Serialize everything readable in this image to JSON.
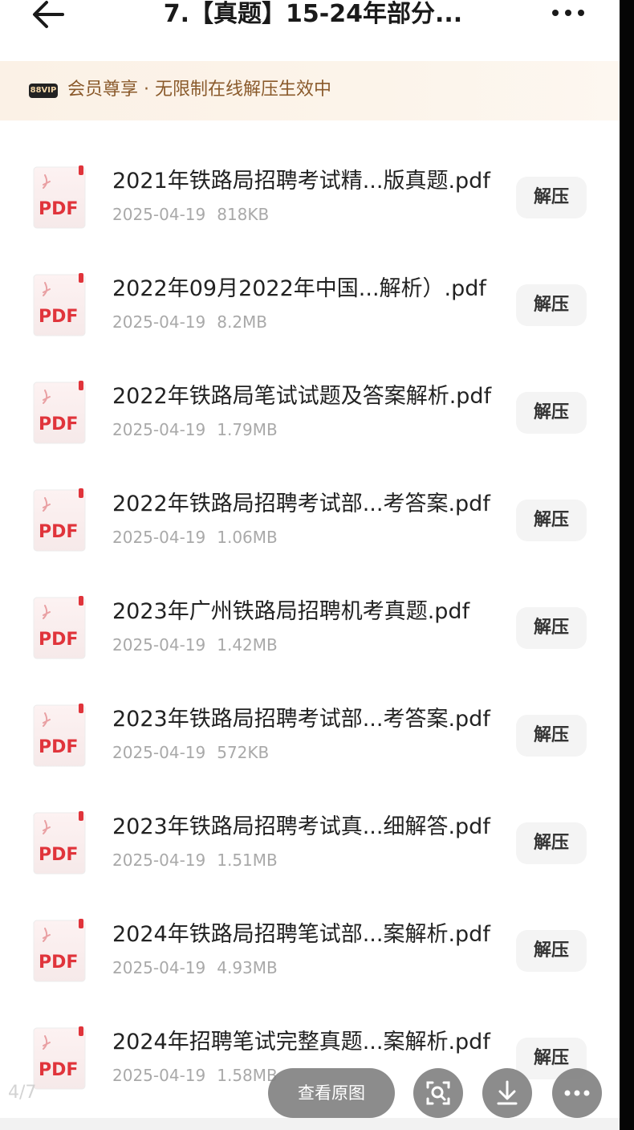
{
  "header": {
    "title": "7.【真题】15-24年部分...",
    "back_icon": "arrow-left-icon",
    "more_icon": "more-horizontal-icon"
  },
  "vip_banner": {
    "badge": "88VIP",
    "text": "会员尊享 · 无限制在线解压生效中"
  },
  "files": [
    {
      "name": "2021年铁路局招聘考试精...版真题.pdf",
      "date": "2025-04-19",
      "size": "818KB",
      "action": "解压"
    },
    {
      "name": "2022年09月2022年中国...解析）.pdf",
      "date": "2025-04-19",
      "size": "8.2MB",
      "action": "解压"
    },
    {
      "name": "2022年铁路局笔试试题及答案解析.pdf",
      "date": "2025-04-19",
      "size": "1.79MB",
      "action": "解压"
    },
    {
      "name": "2022年铁路局招聘考试部...考答案.pdf",
      "date": "2025-04-19",
      "size": "1.06MB",
      "action": "解压"
    },
    {
      "name": "2023年广州铁路局招聘机考真题.pdf",
      "date": "2025-04-19",
      "size": "1.42MB",
      "action": "解压"
    },
    {
      "name": "2023年铁路局招聘考试部...考答案.pdf",
      "date": "2025-04-19",
      "size": "572KB",
      "action": "解压"
    },
    {
      "name": "2023年铁路局招聘考试真...细解答.pdf",
      "date": "2025-04-19",
      "size": "1.51MB",
      "action": "解压"
    },
    {
      "name": "2024年铁路局招聘笔试部...案解析.pdf",
      "date": "2025-04-19",
      "size": "4.93MB",
      "action": "解压"
    },
    {
      "name": "2024年招聘笔试完整真题...案解析.pdf",
      "date": "2025-04-19",
      "size": "1.58MB",
      "action": "解压"
    }
  ],
  "pdf_icon_label": "PDF",
  "viewer": {
    "page_indicator": "4/7",
    "view_original_label": "查看原图",
    "scan_icon": "scan-search-icon",
    "download_icon": "download-icon",
    "more_icon": "more-horizontal-icon"
  },
  "colors": {
    "pdf_red": "#e0343b",
    "vip_text": "#8a5a2b",
    "meta_gray": "#a9a9a9"
  }
}
